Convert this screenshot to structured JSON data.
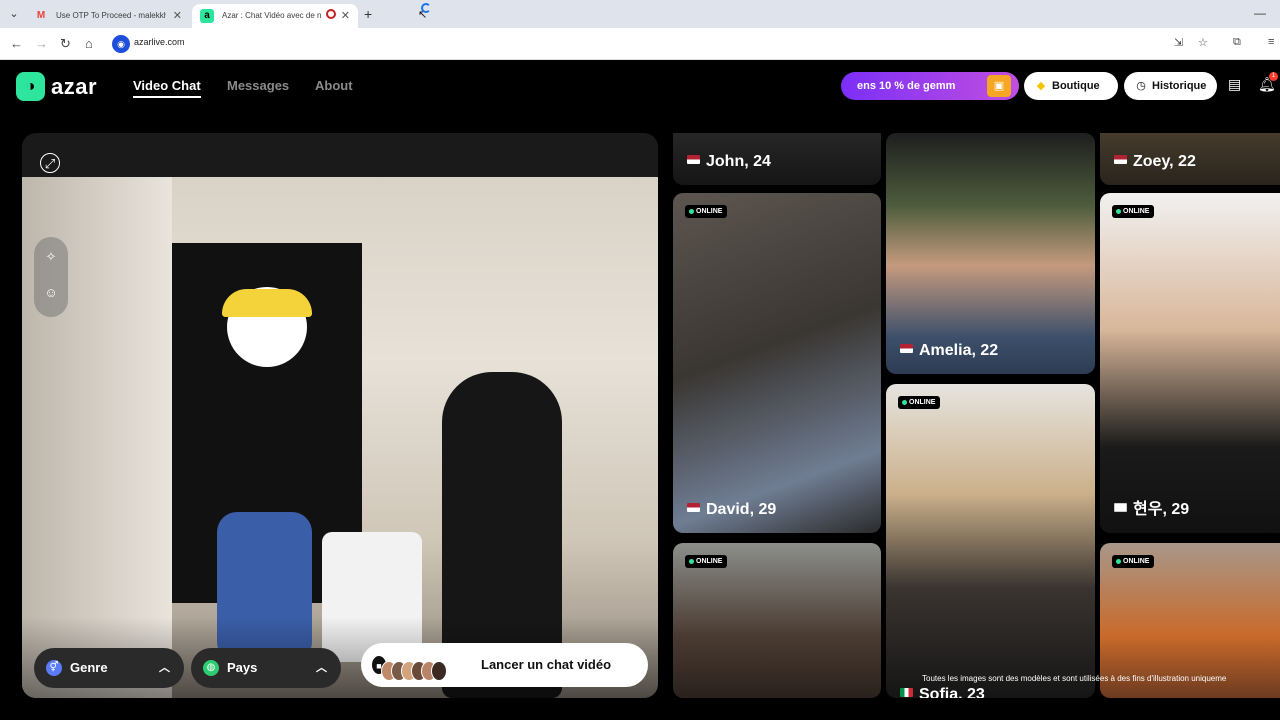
{
  "browser": {
    "tabs": [
      {
        "label": "Use OTP To Proceed - malekkha",
        "icon": "gmail-icon"
      },
      {
        "label": "Azar : Chat Vidéo avec de n",
        "icon": "azar-icon",
        "active": true
      }
    ],
    "new_tab": "+",
    "url": "azarlive.com"
  },
  "header": {
    "logo_text": "azar",
    "nav": [
      {
        "label": "Video Chat",
        "active": true
      },
      {
        "label": "Messages",
        "active": false
      },
      {
        "label": "About",
        "active": false
      }
    ],
    "promo_text": "ens 10 % de gemm",
    "boutique_label": "Boutique",
    "historique_label": "Historique",
    "notification_count": "1"
  },
  "video": {
    "genre_label": "Genre",
    "pays_label": "Pays",
    "launch_label": "Lancer un chat vidéo"
  },
  "online_label": "ONLINE",
  "profiles": [
    {
      "name": "John, 24",
      "flag": "us",
      "online": false
    },
    {
      "name": "David, 29",
      "flag": "us",
      "online": true
    },
    {
      "name": "",
      "flag": "",
      "online": true
    },
    {
      "name": "Amelia, 22",
      "flag": "us",
      "online": false
    },
    {
      "name": "Sofia, 23",
      "flag": "it",
      "online": true
    },
    {
      "name": "Zoey, 22",
      "flag": "us",
      "online": false
    },
    {
      "name": "현우, 29",
      "flag": "kr",
      "online": true
    },
    {
      "name": "",
      "flag": "",
      "online": true
    }
  ],
  "disclaimer": "Toutes les images sont des modèles et sont utilisées à des fins d'illustration uniqueme",
  "colors": {
    "brand": "#2ee59d",
    "promo": "#7b2ff7",
    "background": "#000000"
  }
}
